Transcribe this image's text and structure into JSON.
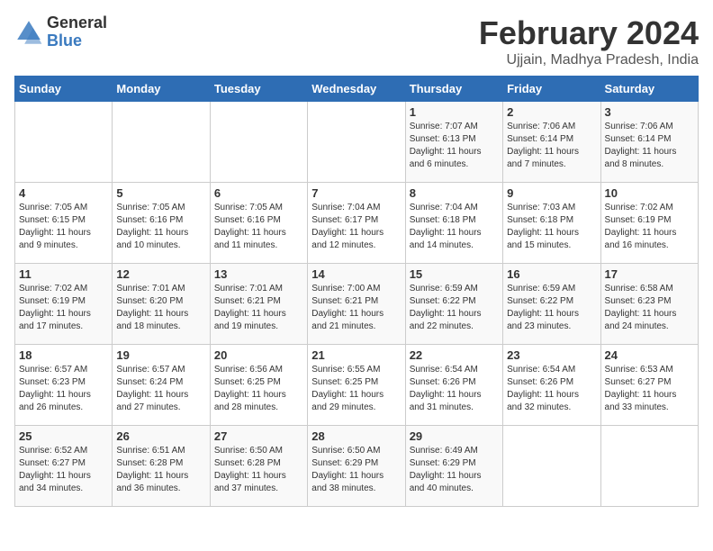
{
  "logo": {
    "general": "General",
    "blue": "Blue"
  },
  "title": "February 2024",
  "location": "Ujjain, Madhya Pradesh, India",
  "days_of_week": [
    "Sunday",
    "Monday",
    "Tuesday",
    "Wednesday",
    "Thursday",
    "Friday",
    "Saturday"
  ],
  "weeks": [
    [
      {
        "day": "",
        "info": ""
      },
      {
        "day": "",
        "info": ""
      },
      {
        "day": "",
        "info": ""
      },
      {
        "day": "",
        "info": ""
      },
      {
        "day": "1",
        "info": "Sunrise: 7:07 AM\nSunset: 6:13 PM\nDaylight: 11 hours\nand 6 minutes."
      },
      {
        "day": "2",
        "info": "Sunrise: 7:06 AM\nSunset: 6:14 PM\nDaylight: 11 hours\nand 7 minutes."
      },
      {
        "day": "3",
        "info": "Sunrise: 7:06 AM\nSunset: 6:14 PM\nDaylight: 11 hours\nand 8 minutes."
      }
    ],
    [
      {
        "day": "4",
        "info": "Sunrise: 7:05 AM\nSunset: 6:15 PM\nDaylight: 11 hours\nand 9 minutes."
      },
      {
        "day": "5",
        "info": "Sunrise: 7:05 AM\nSunset: 6:16 PM\nDaylight: 11 hours\nand 10 minutes."
      },
      {
        "day": "6",
        "info": "Sunrise: 7:05 AM\nSunset: 6:16 PM\nDaylight: 11 hours\nand 11 minutes."
      },
      {
        "day": "7",
        "info": "Sunrise: 7:04 AM\nSunset: 6:17 PM\nDaylight: 11 hours\nand 12 minutes."
      },
      {
        "day": "8",
        "info": "Sunrise: 7:04 AM\nSunset: 6:18 PM\nDaylight: 11 hours\nand 14 minutes."
      },
      {
        "day": "9",
        "info": "Sunrise: 7:03 AM\nSunset: 6:18 PM\nDaylight: 11 hours\nand 15 minutes."
      },
      {
        "day": "10",
        "info": "Sunrise: 7:02 AM\nSunset: 6:19 PM\nDaylight: 11 hours\nand 16 minutes."
      }
    ],
    [
      {
        "day": "11",
        "info": "Sunrise: 7:02 AM\nSunset: 6:19 PM\nDaylight: 11 hours\nand 17 minutes."
      },
      {
        "day": "12",
        "info": "Sunrise: 7:01 AM\nSunset: 6:20 PM\nDaylight: 11 hours\nand 18 minutes."
      },
      {
        "day": "13",
        "info": "Sunrise: 7:01 AM\nSunset: 6:21 PM\nDaylight: 11 hours\nand 19 minutes."
      },
      {
        "day": "14",
        "info": "Sunrise: 7:00 AM\nSunset: 6:21 PM\nDaylight: 11 hours\nand 21 minutes."
      },
      {
        "day": "15",
        "info": "Sunrise: 6:59 AM\nSunset: 6:22 PM\nDaylight: 11 hours\nand 22 minutes."
      },
      {
        "day": "16",
        "info": "Sunrise: 6:59 AM\nSunset: 6:22 PM\nDaylight: 11 hours\nand 23 minutes."
      },
      {
        "day": "17",
        "info": "Sunrise: 6:58 AM\nSunset: 6:23 PM\nDaylight: 11 hours\nand 24 minutes."
      }
    ],
    [
      {
        "day": "18",
        "info": "Sunrise: 6:57 AM\nSunset: 6:23 PM\nDaylight: 11 hours\nand 26 minutes."
      },
      {
        "day": "19",
        "info": "Sunrise: 6:57 AM\nSunset: 6:24 PM\nDaylight: 11 hours\nand 27 minutes."
      },
      {
        "day": "20",
        "info": "Sunrise: 6:56 AM\nSunset: 6:25 PM\nDaylight: 11 hours\nand 28 minutes."
      },
      {
        "day": "21",
        "info": "Sunrise: 6:55 AM\nSunset: 6:25 PM\nDaylight: 11 hours\nand 29 minutes."
      },
      {
        "day": "22",
        "info": "Sunrise: 6:54 AM\nSunset: 6:26 PM\nDaylight: 11 hours\nand 31 minutes."
      },
      {
        "day": "23",
        "info": "Sunrise: 6:54 AM\nSunset: 6:26 PM\nDaylight: 11 hours\nand 32 minutes."
      },
      {
        "day": "24",
        "info": "Sunrise: 6:53 AM\nSunset: 6:27 PM\nDaylight: 11 hours\nand 33 minutes."
      }
    ],
    [
      {
        "day": "25",
        "info": "Sunrise: 6:52 AM\nSunset: 6:27 PM\nDaylight: 11 hours\nand 34 minutes."
      },
      {
        "day": "26",
        "info": "Sunrise: 6:51 AM\nSunset: 6:28 PM\nDaylight: 11 hours\nand 36 minutes."
      },
      {
        "day": "27",
        "info": "Sunrise: 6:50 AM\nSunset: 6:28 PM\nDaylight: 11 hours\nand 37 minutes."
      },
      {
        "day": "28",
        "info": "Sunrise: 6:50 AM\nSunset: 6:29 PM\nDaylight: 11 hours\nand 38 minutes."
      },
      {
        "day": "29",
        "info": "Sunrise: 6:49 AM\nSunset: 6:29 PM\nDaylight: 11 hours\nand 40 minutes."
      },
      {
        "day": "",
        "info": ""
      },
      {
        "day": "",
        "info": ""
      }
    ]
  ]
}
